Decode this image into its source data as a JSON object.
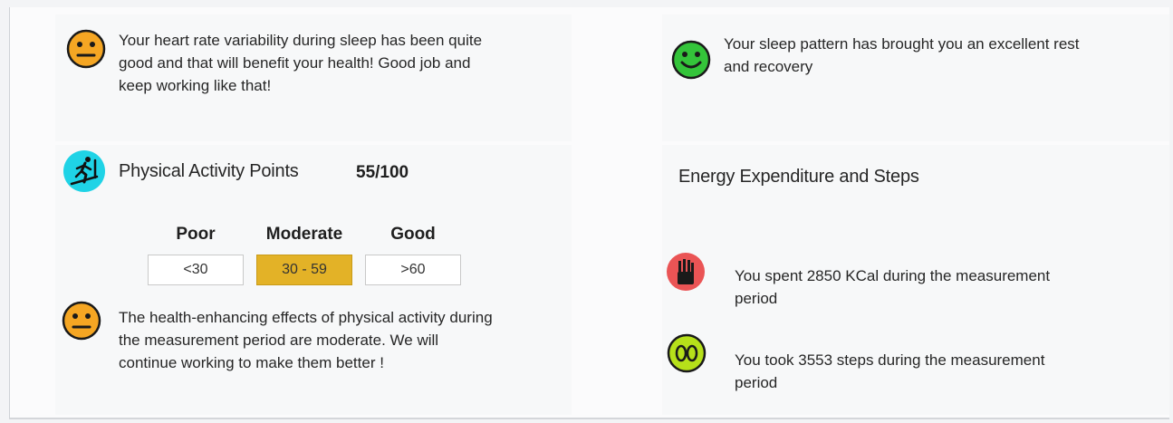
{
  "hrv": {
    "icon": "neutral-face-icon",
    "color": "#f5a623",
    "message": "Your heart rate variability during sleep has been quite good and that will benefit your health! Good job and keep working like that!",
    "lines": [
      "Your heart rate variability during sleep has been quite",
      "good and that will benefit your health! Good job and",
      "keep working like that!"
    ]
  },
  "sleep": {
    "icon": "happy-face-icon",
    "color": "#34c43a",
    "message": "Your sleep pattern has brought you an excellent rest and recovery",
    "lines": [
      "Your sleep pattern has brought you an excellent rest",
      "and recovery"
    ]
  },
  "activity": {
    "icon": "treadmill-runner-icon",
    "icon_color": "#1fd3e6",
    "title": "Physical Activity Points",
    "score": "55/100",
    "levels": [
      {
        "label": "Poor",
        "range": "<30"
      },
      {
        "label": "Moderate",
        "range": "30 - 59"
      },
      {
        "label": "Good",
        "range": ">60"
      }
    ],
    "active_level": "Moderate",
    "active_color": "#e3b227",
    "feedback_icon": "neutral-face-icon",
    "feedback_lines": [
      "The health-enhancing effects of physical activity during",
      "the measurement period are moderate. We will",
      "continue working to make them better !"
    ]
  },
  "energy": {
    "title": "Energy Expenditure and Steps",
    "kcal": {
      "icon": "fries-icon",
      "icon_color": "#ea5455",
      "lines": [
        "You spent 2850 KCal during the measurement",
        "period"
      ]
    },
    "steps": {
      "icon": "footprints-icon",
      "icon_color": "#b6e01a",
      "lines": [
        "You took 3553 steps during the measurement",
        "period"
      ]
    }
  }
}
